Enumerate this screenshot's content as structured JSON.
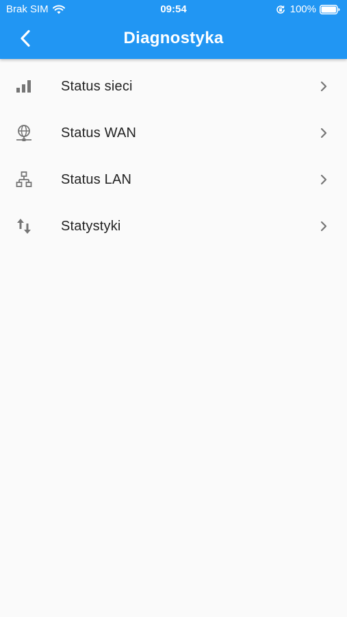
{
  "status_bar": {
    "carrier": "Brak SIM",
    "time": "09:54",
    "battery": "100%"
  },
  "header": {
    "title": "Diagnostyka",
    "back_icon": "chevron-left-icon"
  },
  "menu": {
    "items": [
      {
        "label": "Status sieci",
        "icon": "signal-bars-icon"
      },
      {
        "label": "Status WAN",
        "icon": "globe-network-icon"
      },
      {
        "label": "Status LAN",
        "icon": "lan-hierarchy-icon"
      },
      {
        "label": "Statystyki",
        "icon": "transfer-arrows-icon"
      }
    ]
  },
  "colors": {
    "accent": "#2196f3",
    "icon": "#757575",
    "background": "#fafafa"
  }
}
